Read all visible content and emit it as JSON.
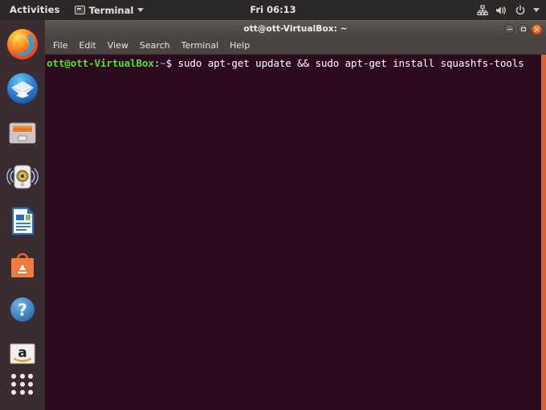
{
  "top_bar": {
    "activities_label": "Activities",
    "app_menu_label": "Terminal",
    "app_menu_icon": "terminal-icon",
    "clock": "Fri 06:13",
    "status_icons": [
      "network-wired-icon",
      "volume-icon",
      "power-icon",
      "chevron-down-icon"
    ]
  },
  "dock": {
    "items": [
      {
        "name": "firefox",
        "label": "Firefox"
      },
      {
        "name": "thunderbird",
        "label": "Thunderbird Mail"
      },
      {
        "name": "files",
        "label": "Files"
      },
      {
        "name": "rhythmbox",
        "label": "Rhythmbox"
      },
      {
        "name": "libreoffice-writer",
        "label": "LibreOffice Writer"
      },
      {
        "name": "ubuntu-software",
        "label": "Ubuntu Software"
      },
      {
        "name": "help",
        "label": "Help"
      },
      {
        "name": "amazon",
        "label": "Amazon"
      }
    ],
    "show_applications_label": "Show Applications"
  },
  "window": {
    "title": "ott@ott-VirtualBox: ~",
    "buttons": {
      "minimize": "minimize",
      "maximize": "maximize",
      "close": "close"
    },
    "menu": [
      "File",
      "Edit",
      "View",
      "Search",
      "Terminal",
      "Help"
    ]
  },
  "terminal": {
    "prompt_user": "ott@ott-VirtualBox",
    "prompt_colon": ":",
    "prompt_path": "~",
    "prompt_dollar": "$ ",
    "command": "sudo apt-get update && sudo apt-get install squashfs-tools",
    "colors": {
      "background": "#2d0b1e",
      "user": "#4ee22e",
      "path": "#5c89f0",
      "text": "#ffffff",
      "scrollbar": "#d4643a"
    }
  }
}
